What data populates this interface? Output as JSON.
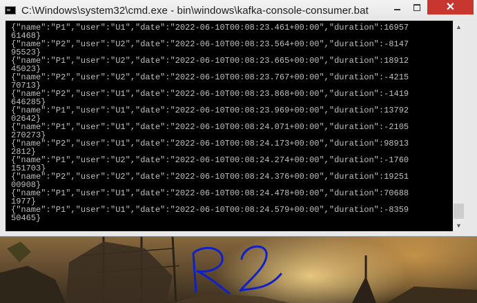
{
  "window": {
    "title": "C:\\Windows\\system32\\cmd.exe - bin\\windows\\kafka-console-consumer.bat",
    "close_symbol": "✕"
  },
  "console": {
    "lines": [
      "{\"name\":\"P1\",\"user\":\"U1\",\"date\":\"2022-06-10T00:08:23.461+00:00\",\"duration\":16957",
      "61468}",
      "{\"name\":\"P2\",\"user\":\"U2\",\"date\":\"2022-06-10T00:08:23.564+00:00\",\"duration\":-8147",
      "95523}",
      "{\"name\":\"P1\",\"user\":\"U2\",\"date\":\"2022-06-10T00:08:23.665+00:00\",\"duration\":18912",
      "45023}",
      "{\"name\":\"P2\",\"user\":\"U2\",\"date\":\"2022-06-10T00:08:23.767+00:00\",\"duration\":-4215",
      "70713}",
      "{\"name\":\"P2\",\"user\":\"U1\",\"date\":\"2022-06-10T00:08:23.868+00:00\",\"duration\":-1419",
      "646285}",
      "{\"name\":\"P1\",\"user\":\"U1\",\"date\":\"2022-06-10T00:08:23.969+00:00\",\"duration\":13792",
      "02642}",
      "{\"name\":\"P1\",\"user\":\"U1\",\"date\":\"2022-06-10T00:08:24.071+00:00\",\"duration\":-2105",
      "270273}",
      "{\"name\":\"P2\",\"user\":\"U1\",\"date\":\"2022-06-10T00:08:24.173+00:00\",\"duration\":98913",
      "2812}",
      "{\"name\":\"P1\",\"user\":\"U2\",\"date\":\"2022-06-10T00:08:24.274+00:00\",\"duration\":-1760",
      "151703}",
      "{\"name\":\"P2\",\"user\":\"U2\",\"date\":\"2022-06-10T00:08:24.376+00:00\",\"duration\":19251",
      "00908}",
      "{\"name\":\"P1\",\"user\":\"U1\",\"date\":\"2022-06-10T00:08:24.478+00:00\",\"duration\":70688",
      "1977}",
      "{\"name\":\"P1\",\"user\":\"U1\",\"date\":\"2022-06-10T00:08:24.579+00:00\",\"duration\":-8359",
      "50465}"
    ]
  },
  "annotation": {
    "text": "R2",
    "color": "#1020c8"
  },
  "colors": {
    "close_button": "#c7372f",
    "console_background": "#000000",
    "console_text": "#c0c0c0"
  },
  "icons": {
    "app": "console-icon",
    "minimize": "minimize-icon",
    "maximize": "maximize-icon",
    "close": "close-icon",
    "scroll_up": "arrow-up-icon",
    "scroll_down": "arrow-down-icon"
  }
}
